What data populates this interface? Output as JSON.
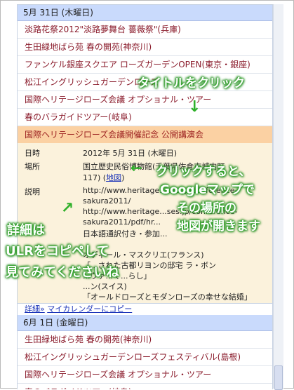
{
  "day1": {
    "header": "5月 31日 (木曜日)",
    "events": [
      "淡路花祭2012\"淡路夢舞台 薔薇祭\"(兵庫)",
      "生田緑地ばら苑 春の開苑(神奈川)",
      "ファンケル銀座スクエア ローズガーデンOPEN(東京・銀座)",
      "松江イングリッシュガーデンローズ",
      "国際ヘリテージローズ会議 オプショナル・ツアー",
      "春のバラガイドツアー(岐阜)"
    ],
    "selected_event": "国際ヘリテージローズ会議開催記念 公開講演会"
  },
  "detail": {
    "date_label": "日時",
    "date_value": "2012年 5月 31日 (木曜日)",
    "place_label": "場所",
    "place_value_1": "国立歴史民俗博物館(千葉県佐倉市城内町",
    "place_value_2": "117)",
    "map_link": "地図",
    "desc_label": "説明",
    "desc_lines": [
      "http://www.heritage...ses.jp/conference-",
      "sakura2011/",
      "http://www.heritage...ses.jp/conference-",
      "sakura2011/pdf/hr...",
      "日本語通訳付き・参加...",
      "",
      "オディール・マスクリエ(フランス)",
      "「...された古都リヨンの邸宅 ラ・ボン",
      "...ヴァ...ぐ...らし」",
      "...ン(スイス)",
      "「オールドローズとモダンローズの幸せな結婚」"
    ],
    "details_link": "詳細»",
    "add_calendar_link": "マイカレンダーにコピー"
  },
  "day2": {
    "header": "6月 1日 (金曜日)",
    "events": [
      "生田緑地ばら苑 春の開苑(神奈川)",
      "松江イングリッシュガーデンローズフェスティバル(島根)",
      "国際ヘリテージローズ会議 オプショナル・ツアー",
      "春のバラガイドツアー(岐阜)"
    ]
  },
  "annotations": {
    "title_click": "タイトルをクリック",
    "map_1": "クリックすると、",
    "map_2": "Googleマップで",
    "map_3": "その場所の",
    "map_4": "地図が開きます",
    "url_1": "詳細は",
    "url_2": "ULRをコピペして",
    "url_3": "見てみてくださいね"
  },
  "colors": {
    "annotation_green": "#2fa32a",
    "selected_event_bg": "#fbd1a3",
    "detail_bg": "#fbf2dc",
    "date_header_bg": "#c9dafc",
    "event_text": "#8a1b2b",
    "link": "#1a33b8"
  }
}
